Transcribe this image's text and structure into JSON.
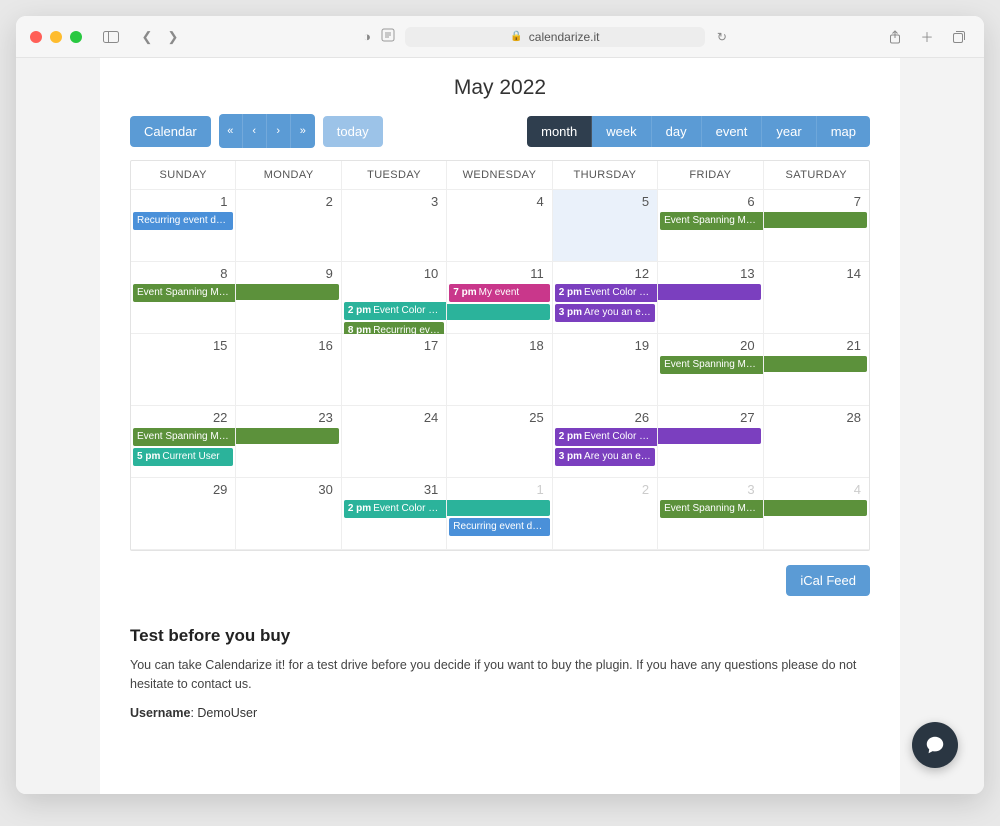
{
  "browser": {
    "url": "calendarize.it"
  },
  "title": "May 2022",
  "toolbar": {
    "calendar_btn": "Calendar",
    "today_btn": "today",
    "views": {
      "month": "month",
      "week": "week",
      "day": "day",
      "event": "event",
      "year": "year",
      "map": "map"
    }
  },
  "dayHeaders": [
    "SUNDAY",
    "MONDAY",
    "TUESDAY",
    "WEDNESDAY",
    "THURSDAY",
    "FRIDAY",
    "SATURDAY"
  ],
  "feed_label": "iCal Feed",
  "colors": {
    "green": "#5c913b",
    "teal": "#2bb39b",
    "blue": "#4a90d9",
    "purple": "#7b3fbf",
    "pink": "#c9378b"
  },
  "today_index": 4,
  "grid": [
    {
      "n": "1",
      "other": false
    },
    {
      "n": "2",
      "other": false
    },
    {
      "n": "3",
      "other": false
    },
    {
      "n": "4",
      "other": false
    },
    {
      "n": "5",
      "other": false
    },
    {
      "n": "6",
      "other": false
    },
    {
      "n": "7",
      "other": false
    },
    {
      "n": "8",
      "other": false
    },
    {
      "n": "9",
      "other": false
    },
    {
      "n": "10",
      "other": false
    },
    {
      "n": "11",
      "other": false
    },
    {
      "n": "12",
      "other": false
    },
    {
      "n": "13",
      "other": false
    },
    {
      "n": "14",
      "other": false
    },
    {
      "n": "15",
      "other": false
    },
    {
      "n": "16",
      "other": false
    },
    {
      "n": "17",
      "other": false
    },
    {
      "n": "18",
      "other": false
    },
    {
      "n": "19",
      "other": false
    },
    {
      "n": "20",
      "other": false
    },
    {
      "n": "21",
      "other": false
    },
    {
      "n": "22",
      "other": false
    },
    {
      "n": "23",
      "other": false
    },
    {
      "n": "24",
      "other": false
    },
    {
      "n": "25",
      "other": false
    },
    {
      "n": "26",
      "other": false
    },
    {
      "n": "27",
      "other": false
    },
    {
      "n": "28",
      "other": false
    },
    {
      "n": "29",
      "other": false
    },
    {
      "n": "30",
      "other": false
    },
    {
      "n": "31",
      "other": false
    },
    {
      "n": "1",
      "other": true
    },
    {
      "n": "2",
      "other": true
    },
    {
      "n": "3",
      "other": true
    },
    {
      "n": "4",
      "other": true
    }
  ],
  "events": [
    {
      "start": 0,
      "span": 1,
      "row": 0,
      "slot": 0,
      "color": "blue",
      "title": "Recurring event demo",
      "time": ""
    },
    {
      "start": 5,
      "span": 2,
      "row": 0,
      "slot": 0,
      "color": "green",
      "title": "Event Spanning Multiple Days",
      "time": ""
    },
    {
      "start": 0,
      "span": 2,
      "row": 1,
      "slot": 0,
      "color": "green",
      "title": "Event Spanning Multiple Days",
      "time": ""
    },
    {
      "start": 3,
      "span": 1,
      "row": 1,
      "slot": 0,
      "color": "pink",
      "title": "My event",
      "time": "7 pm"
    },
    {
      "start": 4,
      "span": 2,
      "row": 1,
      "slot": 0,
      "color": "purple",
      "title": "Event Color by Calendar (Purple)",
      "time": "2 pm"
    },
    {
      "start": 2,
      "span": 2,
      "row": 1,
      "slot": 1,
      "color": "teal",
      "title": "Event Color by Calendar (Green)",
      "time": "2 pm"
    },
    {
      "start": 4,
      "span": 1,
      "row": 1,
      "slot": 1,
      "color": "purple",
      "title": "Are you an entrepreneur?",
      "time": "3 pm"
    },
    {
      "start": 2,
      "span": 1,
      "row": 1,
      "slot": 2,
      "color": "green",
      "title": "Recurring event",
      "time": "8 pm"
    },
    {
      "start": 5,
      "span": 2,
      "row": 2,
      "slot": 0,
      "color": "green",
      "title": "Event Spanning Multiple Days",
      "time": ""
    },
    {
      "start": 0,
      "span": 2,
      "row": 3,
      "slot": 0,
      "color": "green",
      "title": "Event Spanning Multiple Days",
      "time": ""
    },
    {
      "start": 4,
      "span": 2,
      "row": 3,
      "slot": 0,
      "color": "purple",
      "title": "Event Color by Calendar (Purple)",
      "time": "2 pm"
    },
    {
      "start": 0,
      "span": 1,
      "row": 3,
      "slot": 1,
      "color": "teal",
      "title": "Current User",
      "time": "5 pm"
    },
    {
      "start": 4,
      "span": 1,
      "row": 3,
      "slot": 1,
      "color": "purple",
      "title": "Are you an entrepreneur?",
      "time": "3 pm"
    },
    {
      "start": 2,
      "span": 2,
      "row": 4,
      "slot": 0,
      "color": "teal",
      "title": "Event Color by Calendar (Green)",
      "time": "2 pm"
    },
    {
      "start": 5,
      "span": 2,
      "row": 4,
      "slot": 0,
      "color": "green",
      "title": "Event Spanning Multiple Days",
      "time": ""
    },
    {
      "start": 3,
      "span": 1,
      "row": 4,
      "slot": 1,
      "color": "blue",
      "title": "Recurring event demo",
      "time": ""
    }
  ],
  "section": {
    "heading": "Test before you buy",
    "body": "You can take Calendarize it! for a test drive before you decide if you want to buy the plugin. If you have any questions please do not hesitate to con­tact us.",
    "username_label": "Username",
    "username_value": "DemoUser"
  }
}
